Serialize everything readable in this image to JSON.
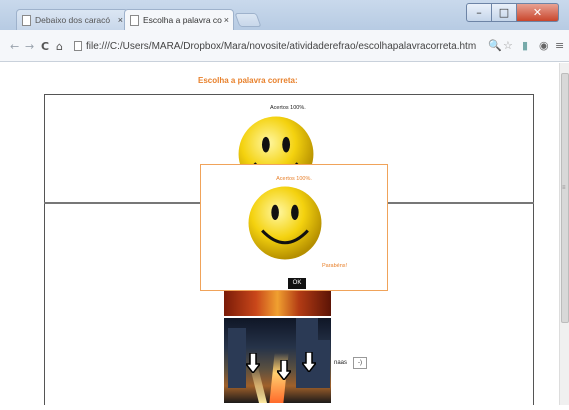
{
  "window": {
    "controls": {
      "minimize": "–",
      "maximize": "□",
      "close": "✕"
    }
  },
  "tabs": [
    {
      "label": "Debaixo dos caracó",
      "close": "×"
    },
    {
      "label": "Escolha a palavra co",
      "close": "×"
    }
  ],
  "toolbar": {
    "back": "←",
    "forward": "→",
    "reload": "C",
    "home": "⌂",
    "url": "file:///C:/Users/MARA/Dropbox/Mara/novosite/atividaderefrao/escolhapalavracorreta.htm",
    "icons": {
      "search": "search-icon",
      "star": "star-icon",
      "bars": "signal-icon",
      "eye": "eye-icon",
      "menu": "menu-icon"
    },
    "search_glyph": "🔍",
    "star_glyph": "☆",
    "bars_glyph": "▮",
    "eye_glyph": "◉",
    "menu_glyph": "≡"
  },
  "page": {
    "title": "Escolha a palavra correta:",
    "score_text": "Acertos 100%.",
    "option_label": "naas",
    "option_value": "-)"
  },
  "dialog": {
    "title": "Acertos 100%.",
    "subtitle": "Parabéns!",
    "ok_label": "OK"
  },
  "colors": {
    "accent": "#e8812c",
    "smiley": "#f4d20f"
  }
}
